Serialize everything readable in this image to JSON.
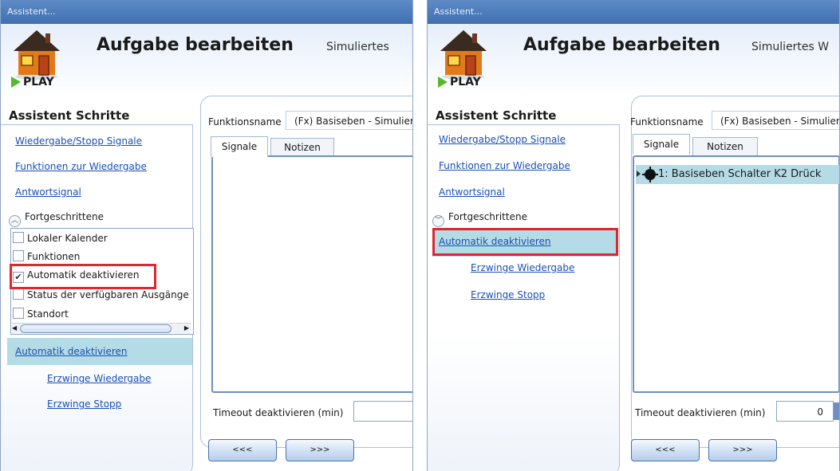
{
  "colors": {
    "titlebar": "#4a79b9",
    "link": "#1a4fb5",
    "highlight": "#b4dbe6",
    "red_frame": "#e0262f",
    "play_green": "#58b82c"
  },
  "panels": [
    {
      "window_title": "Assistent...",
      "play_label": "PLAY",
      "page_title": "Aufgabe bearbeiten",
      "sim_text": "Simuliertes",
      "steps_title": "Assistent Schritte",
      "steps": [
        "Wiedergabe/Stopp Signale",
        "Funktionen zur Wiedergabe",
        "Antwortsignal"
      ],
      "advanced_label": "Fortgeschrittene",
      "advanced_icon": "chevron-up-icon",
      "advanced_options": [
        {
          "label": "Lokaler Kalender",
          "checked": false
        },
        {
          "label": "Funktionen",
          "checked": false
        },
        {
          "label": "Automatik deaktivieren",
          "checked": true
        },
        {
          "label": "Status der verfügbaren Ausgänge",
          "checked": false
        },
        {
          "label": "Standort",
          "checked": false
        }
      ],
      "selected_step": "Automatik deaktivieren",
      "sub_steps": [
        "Erzwinge Wiedergabe",
        "Erzwinge Stopp"
      ],
      "function_name_label": "Funktionsname",
      "function_name_value": "(Fx) Basiseben - Simuliertes Wochenende",
      "tabs": [
        "Signale",
        "Notizen"
      ],
      "signals": [],
      "timeout_label": "Timeout deaktivieren (min)",
      "timeout_value": "",
      "back_button": "<<<",
      "next_button": ">>>"
    },
    {
      "window_title": "Assistent...",
      "play_label": "PLAY",
      "page_title": "Aufgabe bearbeiten",
      "sim_text": "Simuliertes W",
      "steps_title": "Assistent Schritte",
      "steps": [
        "Wiedergabe/Stopp Signale",
        "Funktionen zur Wiedergabe",
        "Antwortsignal"
      ],
      "advanced_label": "Fortgeschrittene",
      "advanced_icon": "chevron-down-icon",
      "selected_step": "Automatik deaktivieren",
      "sub_steps": [
        "Erzwinge Wiedergabe",
        "Erzwinge Stopp"
      ],
      "function_name_label": "Funktionsname",
      "function_name_value": "(Fx) Basiseben - Simuliertes Wochenende",
      "tabs": [
        "Signale",
        "Notizen"
      ],
      "signals": [
        "1: Basiseben Schalter K2 Drück"
      ],
      "timeout_label": "Timeout deaktivieren (min)",
      "timeout_value": "0",
      "back_button": "<<<",
      "next_button": ">>>"
    }
  ]
}
